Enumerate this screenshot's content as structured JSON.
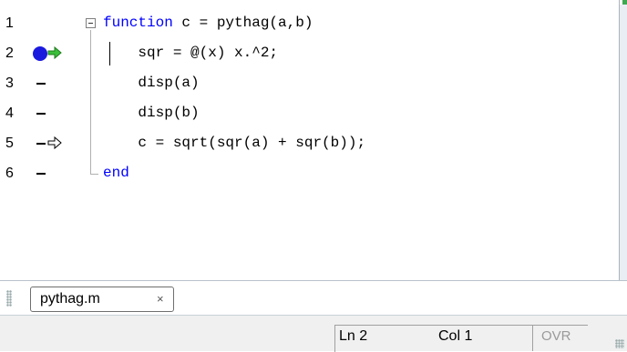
{
  "editor": {
    "lines": [
      {
        "num": "1",
        "kw_before": "function",
        "code": " c = pythag(a,b)",
        "kw_after": ""
      },
      {
        "num": "2",
        "kw_before": "",
        "code": "    sqr = @(x) x.^2;",
        "kw_after": ""
      },
      {
        "num": "3",
        "kw_before": "",
        "code": "    disp(a)",
        "kw_after": ""
      },
      {
        "num": "4",
        "kw_before": "",
        "code": "    disp(b)",
        "kw_after": ""
      },
      {
        "num": "5",
        "kw_before": "",
        "code": "    c = sqrt(sqr(a) + sqr(b));",
        "kw_after": ""
      },
      {
        "num": "6",
        "kw_before": "end",
        "code": "",
        "kw_after": ""
      }
    ],
    "breakpoint_color": "#1a1adf",
    "current_arrow_color": "#39c039",
    "keyword_color": "#0000ff"
  },
  "tab": {
    "label": "pythag.m",
    "close": "×"
  },
  "status": {
    "ln": "Ln  2",
    "col": "Col  1",
    "ovr": "OVR"
  }
}
